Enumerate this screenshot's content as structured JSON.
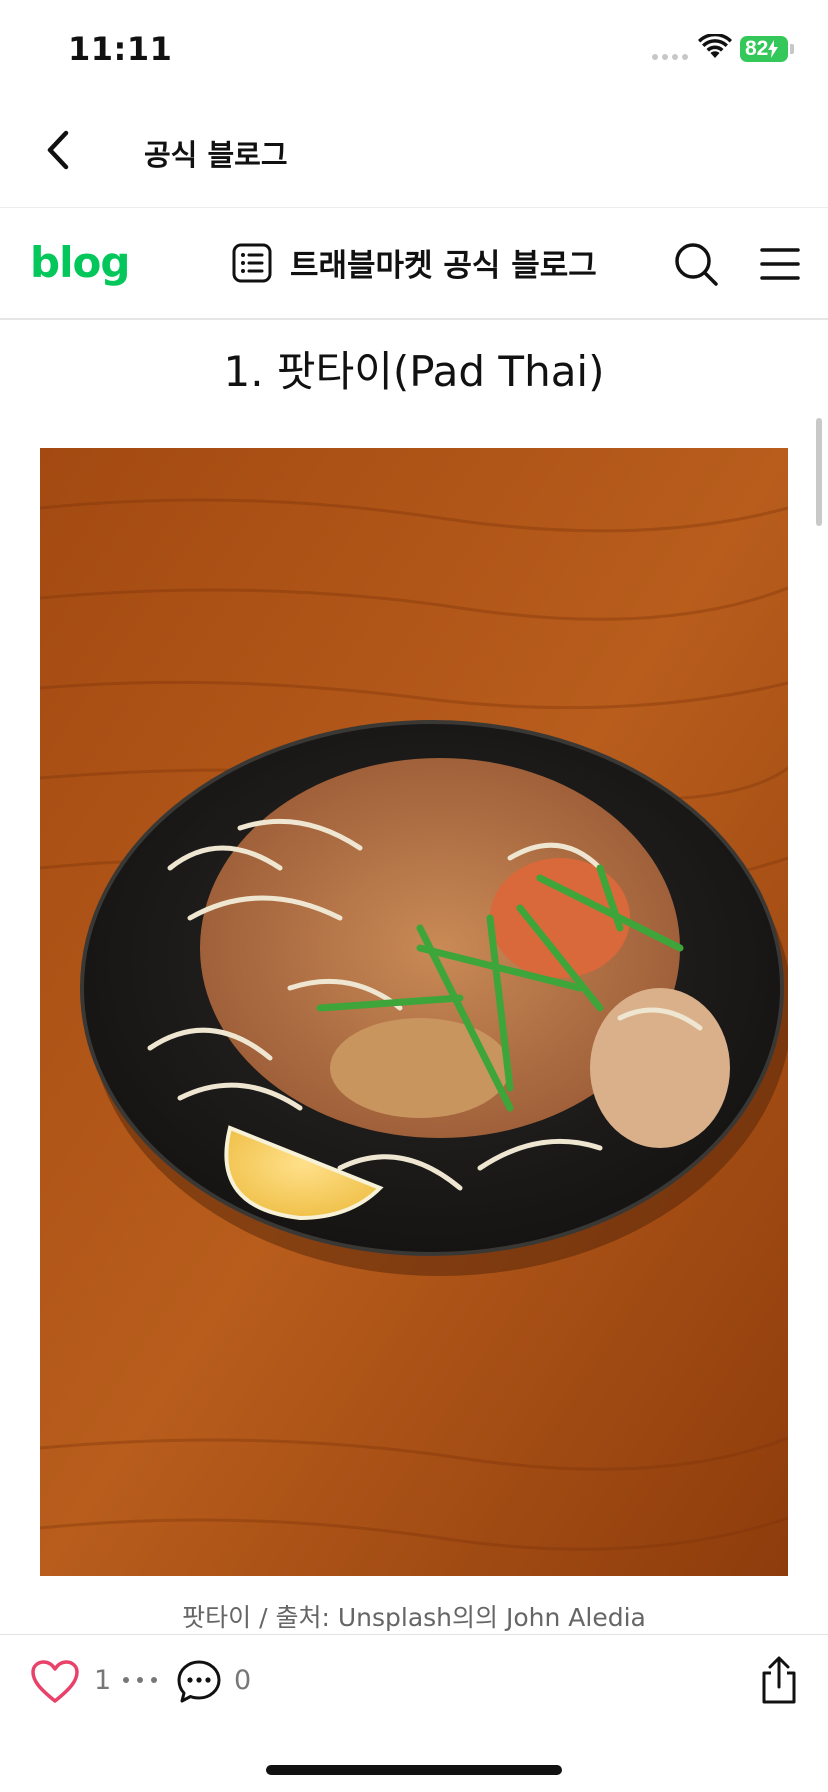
{
  "status_bar": {
    "time": "11:11",
    "battery_level": "82",
    "battery_color": "#34c759"
  },
  "header": {
    "back_icon": "chevron-left-icon",
    "title": "공식 블로그"
  },
  "blog_nav": {
    "logo": "blog",
    "logo_color": "#03c75a",
    "list_icon": "list-icon",
    "blog_name": "트래블마켓 공식 블로그",
    "search_icon": "search-icon",
    "menu_icon": "hamburger-menu-icon"
  },
  "post": {
    "heading": "1. 팟타이(Pad Thai)",
    "image_caption": "팟타이 / 출처: Unsplash의의 John Aledia"
  },
  "bottom_bar": {
    "like_icon": "heart-icon",
    "like_count": "1",
    "more_icon": "more-dots-icon",
    "comment_icon": "comment-icon",
    "comment_count": "0",
    "share_icon": "share-icon",
    "like_color": "#e8416a"
  }
}
